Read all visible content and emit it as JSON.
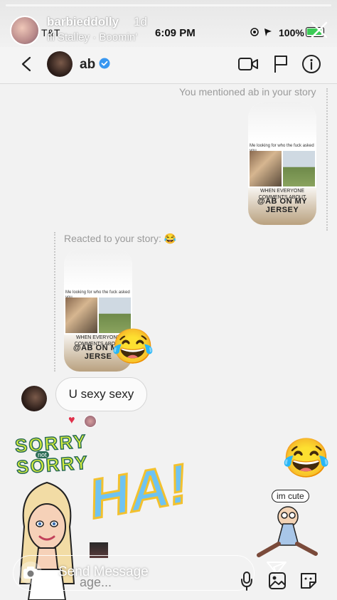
{
  "story": {
    "username": "barbieddolly",
    "time_ago": "1d",
    "music": "Ill Stalley · Boomin' "
  },
  "status_bar": {
    "carrier": "T&T",
    "time": "6:09 PM",
    "battery": "100%"
  },
  "header": {
    "name": "ab"
  },
  "messages": {
    "mention_note": "You mentioned ab in your story",
    "react_note": "Reacted to your story: 😂",
    "story_caption": "Me looking for who the fuck asked you",
    "story_text": "WHEN EVERYONE COMMENTS ABOUT",
    "story_handle": "@AB ON MY JERSEY",
    "story_handle_2": "@AB ON MY JERSE",
    "laugh_emoji": "😂",
    "bubble_text": "U sexy sexy",
    "heart": "♥"
  },
  "stickers": {
    "sorry_line1": "SORRY",
    "sorry_not": "not",
    "sorry_line2": "SORRY",
    "ha": "HA!",
    "im_cute": "im cute",
    "laugh_emoji": "😂"
  },
  "composer": {
    "placeholder": "Send Message",
    "ghost": "age..."
  },
  "colors": {
    "verified": "#3897f0",
    "heart": "#e0304a",
    "battery": "#3bcb55"
  }
}
